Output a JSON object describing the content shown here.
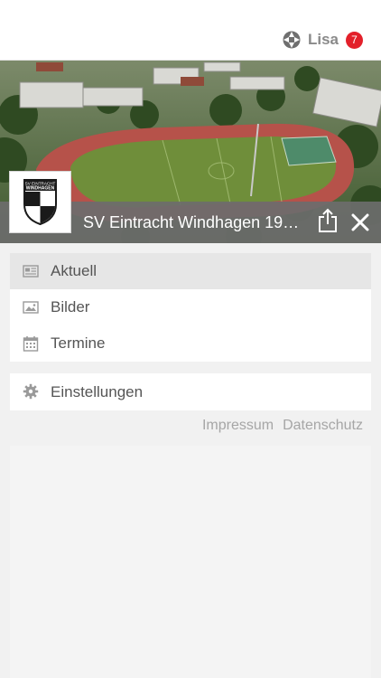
{
  "header": {
    "user_name": "Lisa",
    "notification_count": "7"
  },
  "club": {
    "name": "SV Eintracht Windhagen 1921…",
    "crest_lines": [
      "SV EINTRACHT",
      "WINDHAGEN"
    ]
  },
  "menu": {
    "items": [
      {
        "label": "Aktuell",
        "icon": "news-icon"
      },
      {
        "label": "Bilder",
        "icon": "image-icon"
      },
      {
        "label": "Termine",
        "icon": "calendar-icon"
      }
    ],
    "settings": {
      "label": "Einstellungen",
      "icon": "gear-icon"
    }
  },
  "footer": {
    "impressum": "Impressum",
    "datenschutz": "Datenschutz"
  },
  "colors": {
    "badge": "#e3202a",
    "club_bar": "#6c6c6c",
    "active_item": "#e6e6e6"
  }
}
